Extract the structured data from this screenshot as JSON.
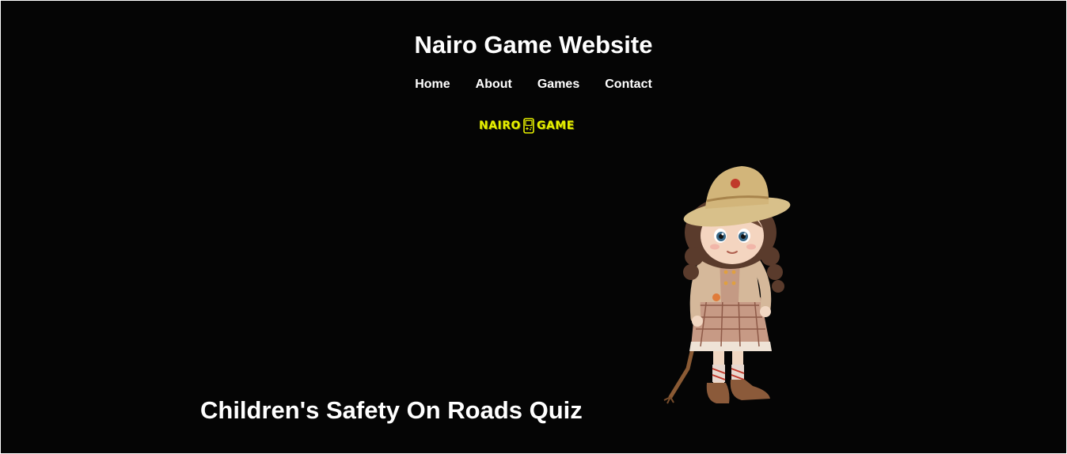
{
  "header": {
    "title": "Nairo Game Website"
  },
  "nav": {
    "items": [
      {
        "label": "Home"
      },
      {
        "label": "About"
      },
      {
        "label": "Games"
      },
      {
        "label": "Contact"
      }
    ]
  },
  "logo": {
    "left_word": "NAIRO",
    "right_word": "GAME",
    "icon": "handheld-console-icon",
    "color": "#e6f000"
  },
  "hero": {
    "image": "girl-character-illustration",
    "quiz_title": "Children's Safety On Roads Quiz"
  },
  "colors": {
    "background": "#050505",
    "text": "#ffffff",
    "logo_accent": "#e6f000"
  }
}
